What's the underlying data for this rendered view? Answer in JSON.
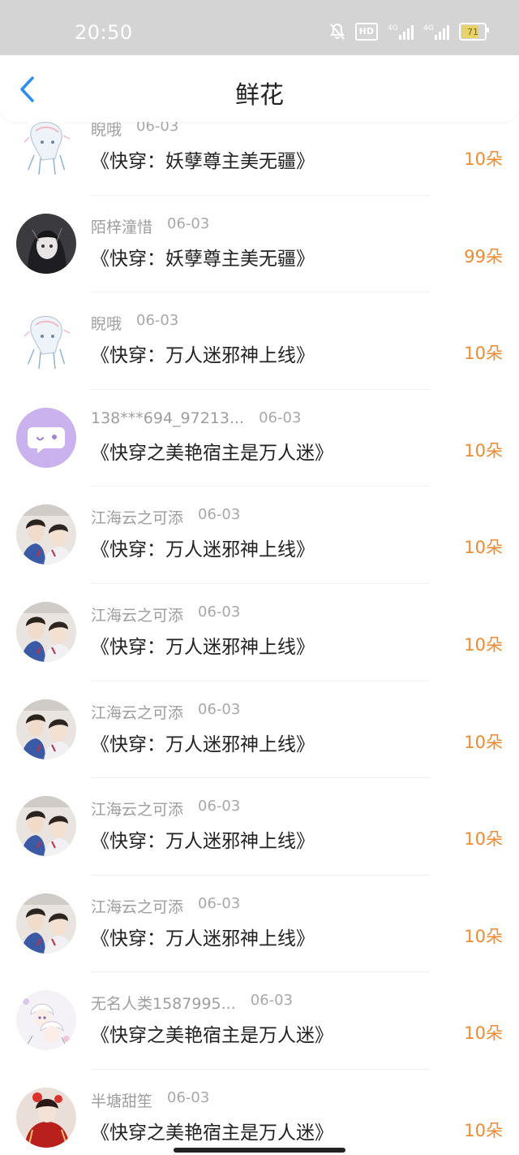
{
  "status_bar": {
    "time": "20:50",
    "hd_label": "HD",
    "network1": "4G",
    "network2": "4G",
    "battery": "71"
  },
  "header": {
    "title": "鲜花"
  },
  "colors": {
    "accent_orange": "#f08a30",
    "back_arrow": "#2a8ef5",
    "name_gray": "#9e9e9e"
  },
  "list": [
    {
      "name": "睨哦",
      "date": "06-03",
      "book": "《快穿：妖孽尊主美无疆》",
      "flowers": "10朵",
      "avatar": "anime-girl-sketch"
    },
    {
      "name": "陌梓潼惜",
      "date": "06-03",
      "book": "《快穿：妖孽尊主美无疆》",
      "flowers": "99朵",
      "avatar": "dark-hair-girl"
    },
    {
      "name": "睨哦",
      "date": "06-03",
      "book": "《快穿：万人迷邪神上线》",
      "flowers": "10朵",
      "avatar": "anime-girl-sketch"
    },
    {
      "name": "138***694_97213...",
      "date": "06-03",
      "book": "《快穿之美艳宿主是万人迷》",
      "flowers": "10朵",
      "avatar": "default-chat-bubble"
    },
    {
      "name": "江海云之可添",
      "date": "06-03",
      "book": "《快穿：万人迷邪神上线》",
      "flowers": "10朵",
      "avatar": "two-boys"
    },
    {
      "name": "江海云之可添",
      "date": "06-03",
      "book": "《快穿：万人迷邪神上线》",
      "flowers": "10朵",
      "avatar": "two-boys"
    },
    {
      "name": "江海云之可添",
      "date": "06-03",
      "book": "《快穿：万人迷邪神上线》",
      "flowers": "10朵",
      "avatar": "two-boys"
    },
    {
      "name": "江海云之可添",
      "date": "06-03",
      "book": "《快穿：万人迷邪神上线》",
      "flowers": "10朵",
      "avatar": "two-boys"
    },
    {
      "name": "江海云之可添",
      "date": "06-03",
      "book": "《快穿：万人迷邪神上线》",
      "flowers": "10朵",
      "avatar": "two-boys"
    },
    {
      "name": "无名人类1587995...",
      "date": "06-03",
      "book": "《快穿之美艳宿主是万人迷》",
      "flowers": "10朵",
      "avatar": "white-hair-boys"
    },
    {
      "name": "半塘甜笙",
      "date": "06-03",
      "book": "《快穿之美艳宿主是万人迷》",
      "flowers": "10朵",
      "avatar": "red-robe-girl"
    }
  ]
}
